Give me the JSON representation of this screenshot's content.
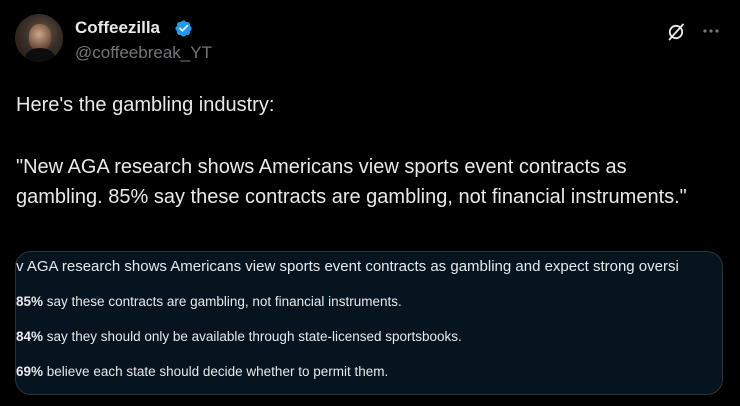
{
  "author": {
    "display_name": "Coffeezilla",
    "handle": "@coffeebreak_YT",
    "verified_color": "#1d9bf0"
  },
  "tweet": {
    "line1": "Here's the gambling industry:",
    "line2": "\"New AGA research shows Americans view sports event contracts as gambling. 85% say these contracts are gambling, not financial instruments.\""
  },
  "media": {
    "headline": "v AGA research shows Americans view sports event contracts as gambling and expect strong oversi",
    "stats": [
      {
        "value": "85%",
        "text": " say these contracts are gambling, not financial instruments."
      },
      {
        "value": "84%",
        "text": " say they should only be available through state-licensed sportsbooks."
      },
      {
        "value": "69%",
        "text": " believe each state should decide whether to permit them."
      }
    ]
  },
  "icons": {
    "verified": "verified-badge-icon",
    "grok": "grok-icon",
    "more": "more-icon"
  }
}
